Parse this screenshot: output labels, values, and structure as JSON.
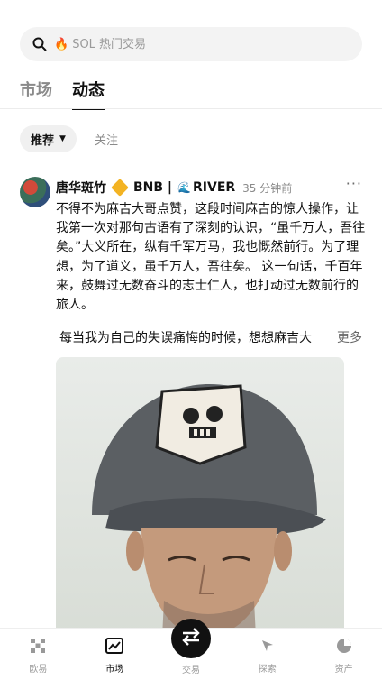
{
  "search": {
    "emoji": "🔥",
    "placeholder": "SOL 热门交易"
  },
  "tabs": [
    {
      "label": "市场",
      "active": false
    },
    {
      "label": "动态",
      "active": true
    }
  ],
  "filter": {
    "selected": "推荐",
    "follow": "关注"
  },
  "post": {
    "author": "唐华斑竹",
    "badge": "BNB |",
    "river": "RIVER",
    "time": "35 分钟前",
    "more": "···",
    "text": "不得不为麻吉大哥点赞，这段时间麻吉的惊人操作，让我第一次对那句古语有了深刻的认识，“虽千万人，吾往矣。”大义所在，纵有千军万马，我也慨然前行。为了理想，为了道义，虽千万人，吾往矣。 这一句话，千百年来，鼓舞过无数奋斗的志士仁人，也打动过无数前行的旅人。",
    "snippet": "每当我为自己的失误痛悔的时候，想想麻吉大",
    "read_more": "更多",
    "photo_alt": "man-wearing-cap-photo"
  },
  "bottom_nav": [
    {
      "label": "欧易",
      "icon": "okx-logo-icon",
      "active": false
    },
    {
      "label": "市场",
      "icon": "chart-icon",
      "active": true
    },
    {
      "label": "交易",
      "icon": "swap-arrows-icon",
      "active": false
    },
    {
      "label": "探索",
      "icon": "compass-icon",
      "active": false
    },
    {
      "label": "资产",
      "icon": "pie-chart-icon",
      "active": false
    }
  ]
}
